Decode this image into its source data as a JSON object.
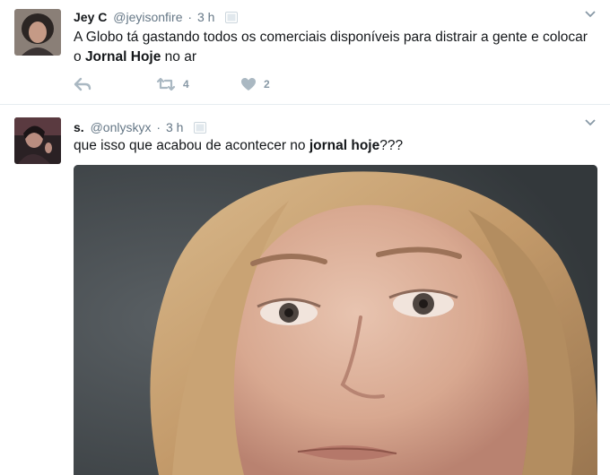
{
  "tweets": [
    {
      "fullname": "Jey C",
      "username": "@jeyisonfire",
      "separator": "·",
      "time": "3 h",
      "text_parts": [
        "A Globo tá gastando todos os comerciais disponíveis para distrair a gente e colocar o ",
        "Jornal Hoje",
        " no ar"
      ],
      "actions": {
        "retweet_count": "4",
        "like_count": "2"
      }
    },
    {
      "fullname": "s.",
      "username": "@onlyskyx",
      "separator": "·",
      "time": "3 h",
      "text_parts": [
        "que isso que acabou de acontecer no ",
        "jornal hoje",
        "???"
      ]
    }
  ],
  "colors": {
    "text": "#14171a",
    "secondary": "#657786",
    "action_icon": "#aab8c2",
    "divider": "#e6ecf0"
  },
  "icons": [
    "reply-icon",
    "retweet-icon",
    "like-icon",
    "caret-down-icon",
    "image-badge-icon"
  ]
}
